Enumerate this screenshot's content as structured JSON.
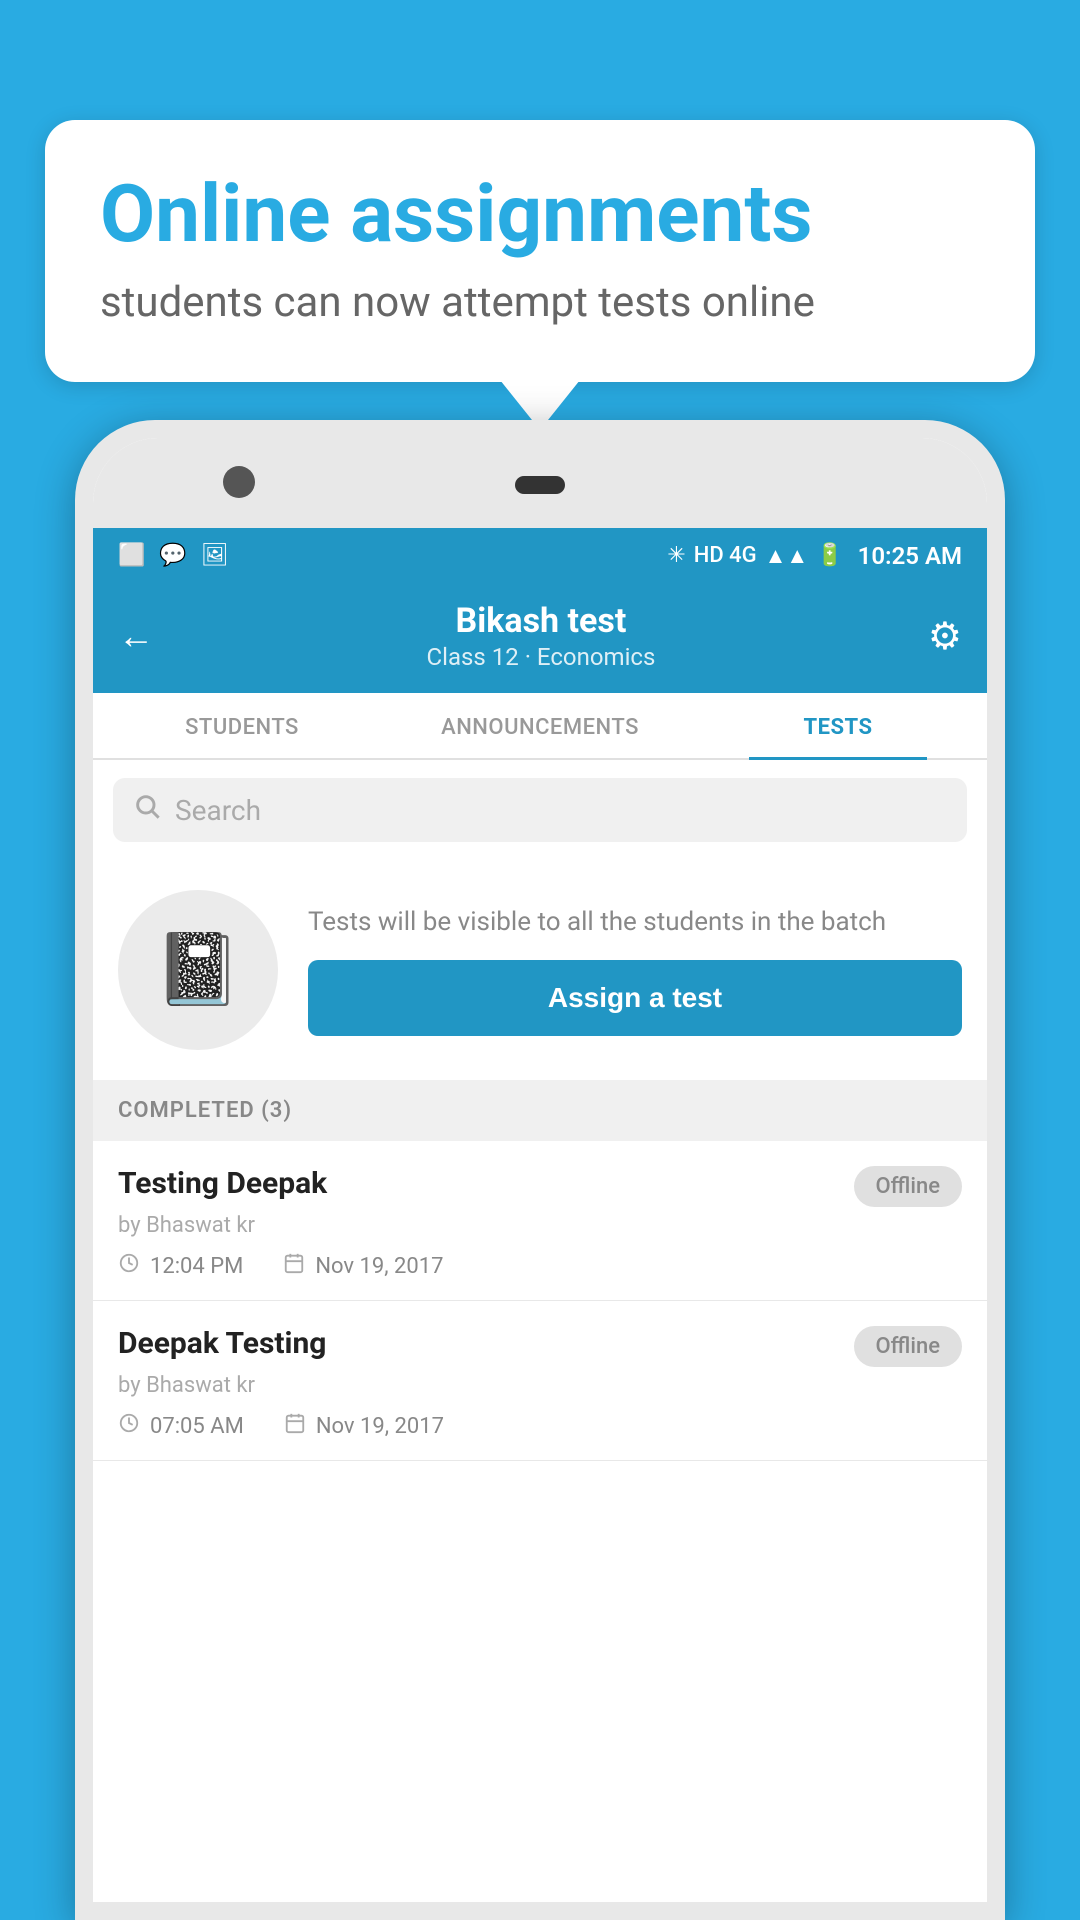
{
  "background_color": "#29ABE2",
  "bubble": {
    "title": "Online assignments",
    "subtitle": "students can now attempt tests online"
  },
  "status_bar": {
    "time": "10:25 AM",
    "icons_left": [
      "app1",
      "whatsapp",
      "gallery"
    ],
    "signal": "HD 4G"
  },
  "header": {
    "title": "Bikash test",
    "subtitle": "Class 12 · Economics",
    "back_label": "←",
    "settings_label": "⚙"
  },
  "tabs": [
    {
      "label": "STUDENTS",
      "active": false
    },
    {
      "label": "ANNOUNCEMENTS",
      "active": false
    },
    {
      "label": "TESTS",
      "active": true
    }
  ],
  "search": {
    "placeholder": "Search"
  },
  "assign_section": {
    "description": "Tests will be visible to all the students in the batch",
    "button_label": "Assign a test",
    "icon": "📓"
  },
  "completed_section": {
    "header": "COMPLETED (3)",
    "items": [
      {
        "name": "Testing Deepak",
        "author": "by Bhaswat kr",
        "time": "12:04 PM",
        "date": "Nov 19, 2017",
        "badge": "Offline"
      },
      {
        "name": "Deepak Testing",
        "author": "by Bhaswat kr",
        "time": "07:05 AM",
        "date": "Nov 19, 2017",
        "badge": "Offline"
      }
    ]
  }
}
